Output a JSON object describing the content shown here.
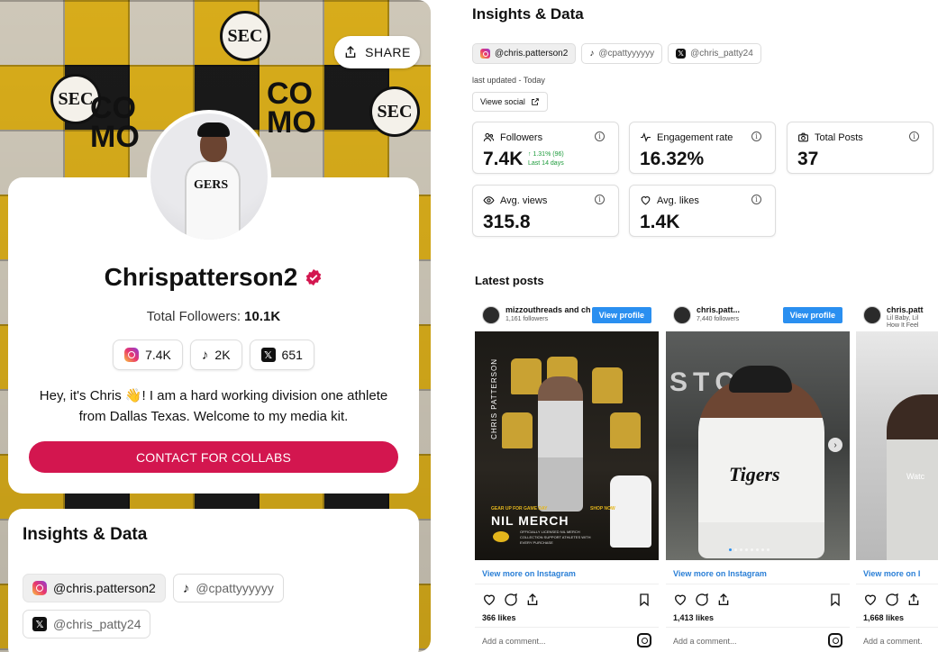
{
  "left": {
    "share_label": "SHARE",
    "profile": {
      "name": "Chrispatterson2",
      "total_followers_label": "Total Followers:",
      "total_followers_value": "10.1K",
      "socials": [
        {
          "platform": "instagram",
          "icon": "instagram-icon",
          "count": "7.4K"
        },
        {
          "platform": "tiktok",
          "icon": "tiktok-icon",
          "count": "2K"
        },
        {
          "platform": "x",
          "icon": "x-icon",
          "count": "651"
        }
      ],
      "bio": "Hey, it's Chris 👋! I am a hard working division one athlete from Dallas Texas. Welcome to my media kit.",
      "contact_label": "CONTACT FOR COLLABS",
      "accent_color": "#d3164f",
      "avatar_jersey_text": "GERS"
    },
    "insights": {
      "title": "Insights & Data",
      "handles": [
        {
          "platform": "instagram",
          "handle": "@chris.patterson2",
          "active": true
        },
        {
          "platform": "tiktok",
          "handle": "@cpattyyyyyy",
          "active": false
        },
        {
          "platform": "x",
          "handle": "@chris_patty24",
          "active": false
        }
      ]
    },
    "background_text": {
      "sec": "SEC",
      "como": "CO\nMO"
    }
  },
  "right": {
    "title": "Insights & Data",
    "handles": [
      {
        "platform": "instagram",
        "handle": "@chris.patterson2",
        "active": true
      },
      {
        "platform": "tiktok",
        "handle": "@cpattyyyyyy",
        "active": false
      },
      {
        "platform": "x",
        "handle": "@chris_patty24",
        "active": false
      }
    ],
    "last_updated": "last updated - Today",
    "view_social_label": "Viewe social",
    "stats": [
      {
        "label": "Followers",
        "icon": "users-icon",
        "value": "7.4K",
        "growth": "↑ 1.31% (96)",
        "growth_period": "Last 14 days"
      },
      {
        "label": "Engagement rate",
        "icon": "pulse-icon",
        "value": "16.32%"
      },
      {
        "label": "Total Posts",
        "icon": "camera-icon",
        "value": "37"
      },
      {
        "label": "Avg. views",
        "icon": "eye-icon",
        "value": "315.8"
      },
      {
        "label": "Avg. likes",
        "icon": "heart-icon",
        "value": "1.4K"
      }
    ],
    "latest_posts_title": "Latest posts",
    "posts": [
      {
        "account": "mizzouthreads and ch",
        "followers": "1,161 followers",
        "view_profile": "View profile",
        "view_more": "View more on Instagram",
        "likes": "366 likes",
        "comment_placeholder": "Add a comment...",
        "image_text": {
          "side": "CHRIS PATTERSON",
          "merch": "NIL MERCH",
          "gear": "GEAR UP FOR GAME DAY",
          "shop": "SHOP NOW",
          "tiny": "OFFICIALLY LICENSED NIL MERCH COLLECTION SUPPORT ATHLETES WITH EVERY PURCHASE"
        }
      },
      {
        "account": "chris.patt...",
        "followers": "7,440 followers",
        "view_profile": "View profile",
        "view_more": "View more on Instagram",
        "likes": "1,413 likes",
        "comment_placeholder": "Add a comment...",
        "image_text": {
          "wall": "STC ®",
          "jersey": "Tigers"
        }
      },
      {
        "account": "chris.patt",
        "followers": "Lil Baby, Lil\nHow It Feel",
        "view_profile": "",
        "view_more": "View more on I",
        "likes": "1,668 likes",
        "comment_placeholder": "Add a comment.",
        "image_text": {
          "watch": "Watc"
        }
      }
    ]
  }
}
